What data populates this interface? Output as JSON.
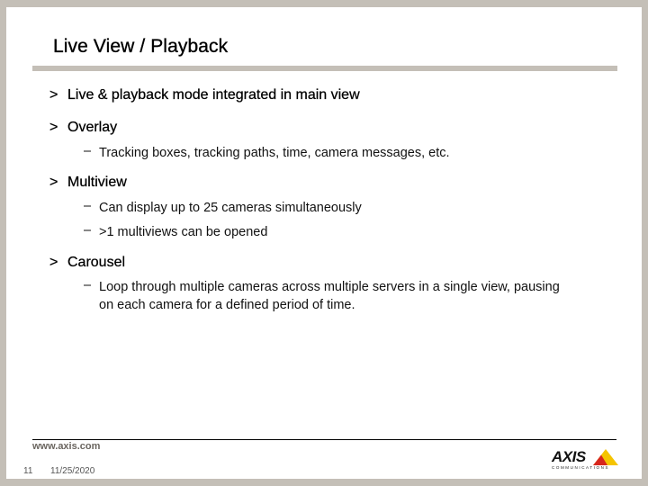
{
  "slide": {
    "title": "Live View / Playback",
    "bullets": [
      {
        "marker": ">",
        "text": "Live & playback mode integrated in main view",
        "subs": []
      },
      {
        "marker": ">",
        "text": "Overlay",
        "subs": [
          {
            "marker": "–",
            "text": "Tracking boxes, tracking paths, time, camera messages, etc."
          }
        ]
      },
      {
        "marker": ">",
        "text": "Multiview",
        "subs": [
          {
            "marker": "–",
            "text": "Can display up to 25 cameras simultaneously"
          },
          {
            "marker": "–",
            "text": ">1 multiviews can be opened"
          }
        ]
      },
      {
        "marker": ">",
        "text": "Carousel",
        "subs": [
          {
            "marker": "–",
            "text": "Loop through multiple cameras across multiple servers in a single view, pausing on each camera for a defined period of time."
          }
        ]
      }
    ]
  },
  "footer": {
    "url": "www.axis.com",
    "page_number": "11",
    "date": "11/25/2020",
    "logo": {
      "name": "AXIS",
      "tagline": "COMMUNICATIONS",
      "accent_yellow": "#f5c400",
      "accent_red": "#d7261e"
    }
  }
}
